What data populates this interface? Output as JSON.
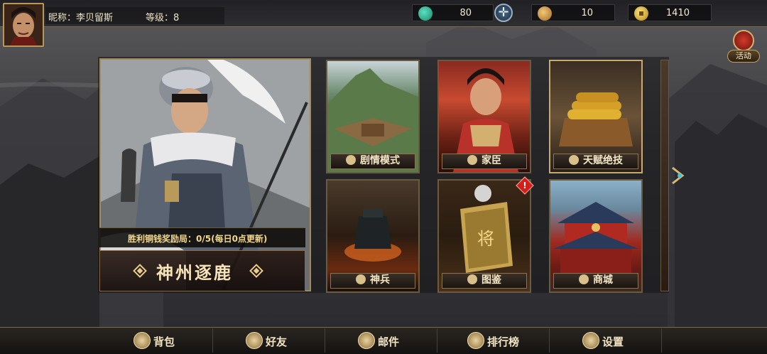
{
  "player": {
    "nickname": "昵称：李贝留斯",
    "level": "等级：8"
  },
  "resources": [
    {
      "icon": "jade-icon",
      "value": "80"
    },
    {
      "icon": "ingot-icon",
      "value": "10"
    },
    {
      "icon": "coin-icon",
      "value": "1410"
    }
  ],
  "event": {
    "label": "活动"
  },
  "hero": {
    "reward": "胜利铜钱奖励局：0/5(每日0点更新)",
    "title": "神州逐鹿"
  },
  "tiles": [
    {
      "label": "剧情模式",
      "icon": "scroll-icon"
    },
    {
      "label": "家臣",
      "icon": "helmet-icon"
    },
    {
      "label": "天赋绝技",
      "icon": "talent-icon"
    },
    {
      "label": "神兵",
      "icon": "weapon-icon"
    },
    {
      "label": "图鉴",
      "icon": "book-icon"
    },
    {
      "label": "商城",
      "icon": "shop-icon"
    }
  ],
  "alert": "!",
  "nav": [
    {
      "label": "背包",
      "icon": "bag-icon"
    },
    {
      "label": "好友",
      "icon": "friend-icon"
    },
    {
      "label": "邮件",
      "icon": "mail-icon"
    },
    {
      "label": "排行榜",
      "icon": "trophy-icon"
    },
    {
      "label": "设置",
      "icon": "settings-icon"
    }
  ]
}
